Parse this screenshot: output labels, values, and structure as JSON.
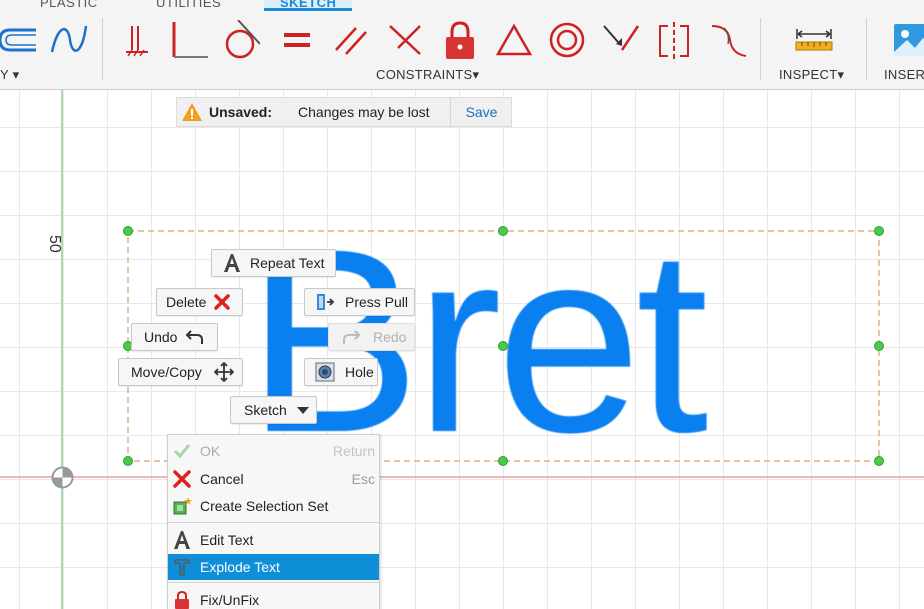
{
  "ribbon": {
    "tabs": [
      "PLASTIC",
      "UTILITIES",
      "SKETCH"
    ],
    "active_tab": "SKETCH",
    "groups": {
      "modify_partial": "Y",
      "constraints": "CONSTRAINTS",
      "inspect": "INSPECT",
      "insert_partial": "INSER"
    },
    "dropdown_glyph": "▾"
  },
  "banner": {
    "title": "Unsaved:",
    "message": "Changes may be lost",
    "save": "Save"
  },
  "viewport": {
    "axis_value": "50",
    "sketch_text": "Bret"
  },
  "marking_menu": {
    "repeat_text": "Repeat Text",
    "delete": "Delete",
    "press_pull": "Press Pull",
    "undo": "Undo",
    "redo": "Redo",
    "move_copy": "Move/Copy",
    "hole": "Hole",
    "sketch": "Sketch"
  },
  "context_menu": {
    "ok": "OK",
    "ok_shortcut": "Return",
    "cancel": "Cancel",
    "cancel_shortcut": "Esc",
    "create_selection_set": "Create Selection Set",
    "edit_text": "Edit Text",
    "explode_text": "Explode Text",
    "fix_unfix": "Fix/UnFix"
  },
  "colors": {
    "sketch_text": "#0a7ff0",
    "constraint_red": "#cc2222",
    "highlight": "#0f8fd8",
    "accent_tab": "#1a8ad8",
    "warning": "#f0a020"
  }
}
